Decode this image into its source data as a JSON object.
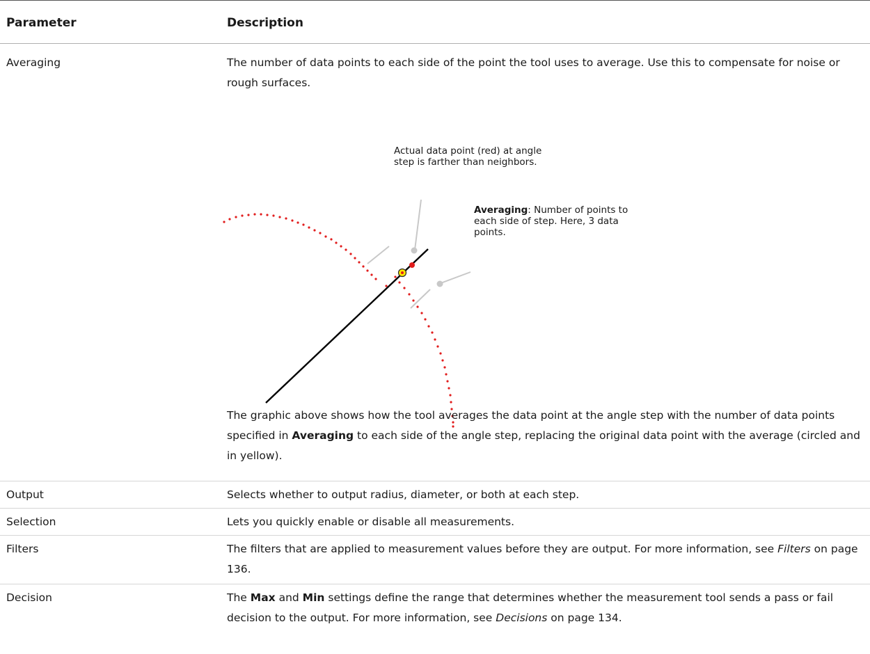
{
  "table": {
    "headers": {
      "parameter": "Parameter",
      "description": "Description"
    },
    "averaging": {
      "parameter": "Averaging",
      "intro": "The number of data points to each side of the point the tool uses to average. Use this to compensate for noise or rough surfaces.",
      "diagram": {
        "callout_top": "Actual data point (red) at angle step is farther than neighbors.",
        "callout_right_bold": "Averaging",
        "callout_right_rest": ": Number of points to each side of step. Here, 3 data points.",
        "colors": {
          "data_points": "#e11d1d",
          "averaged_point": "#ffe600",
          "guide": "#c8c8c8",
          "ray": "#000000"
        }
      },
      "outro_1": "The graphic above shows how the tool averages the data point at the angle step with the number of data points specified in ",
      "outro_bold": "Averaging",
      "outro_2": " to each side of the angle step, replacing the original data point with the average (circled and in yellow)."
    },
    "output": {
      "parameter": "Output",
      "description": "Selects whether to output radius, diameter, or both at each step."
    },
    "selection": {
      "parameter": "Selection",
      "description": "Lets you quickly enable or disable all measurements."
    },
    "filters": {
      "parameter": "Filters",
      "desc_1": "The filters that are applied to measurement values before they are output. For more information, see ",
      "desc_italic": "Filters",
      "desc_2": " on page 136."
    },
    "decision": {
      "parameter": "Decision",
      "desc_1": "The ",
      "desc_bold_1": "Max",
      "desc_2": " and ",
      "desc_bold_2": "Min",
      "desc_3": " settings define the range that determines whether the measurement tool sends a pass or fail decision to the output. For more information, see ",
      "desc_italic": "Decisions",
      "desc_4": " on page 134."
    }
  }
}
